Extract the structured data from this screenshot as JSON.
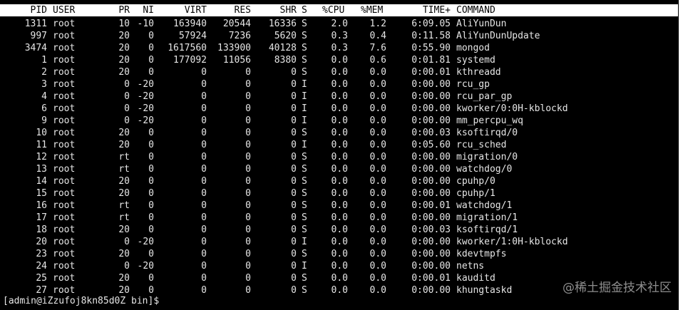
{
  "columns": {
    "pid": "PID",
    "user": "USER",
    "pr": "PR",
    "ni": "NI",
    "virt": "VIRT",
    "res": "RES",
    "shr": "SHR",
    "s": "S",
    "cpu": "%CPU",
    "mem": "%MEM",
    "time": "TIME+",
    "command": "COMMAND"
  },
  "processes": [
    {
      "pid": "1311",
      "user": "root",
      "pr": "10",
      "ni": "-10",
      "virt": "163940",
      "res": "20544",
      "shr": "16336",
      "s": "S",
      "cpu": "2.0",
      "mem": "1.2",
      "time": "6:09.05",
      "command": "AliYunDun"
    },
    {
      "pid": "997",
      "user": "root",
      "pr": "20",
      "ni": "0",
      "virt": "57924",
      "res": "7236",
      "shr": "5620",
      "s": "S",
      "cpu": "0.3",
      "mem": "0.4",
      "time": "0:11.58",
      "command": "AliYunDunUpdate"
    },
    {
      "pid": "3474",
      "user": "root",
      "pr": "20",
      "ni": "0",
      "virt": "1617560",
      "res": "133900",
      "shr": "40128",
      "s": "S",
      "cpu": "0.3",
      "mem": "7.6",
      "time": "0:55.90",
      "command": "mongod"
    },
    {
      "pid": "1",
      "user": "root",
      "pr": "20",
      "ni": "0",
      "virt": "177092",
      "res": "11056",
      "shr": "8380",
      "s": "S",
      "cpu": "0.0",
      "mem": "0.6",
      "time": "0:01.81",
      "command": "systemd"
    },
    {
      "pid": "2",
      "user": "root",
      "pr": "20",
      "ni": "0",
      "virt": "0",
      "res": "0",
      "shr": "0",
      "s": "S",
      "cpu": "0.0",
      "mem": "0.0",
      "time": "0:00.01",
      "command": "kthreadd"
    },
    {
      "pid": "3",
      "user": "root",
      "pr": "0",
      "ni": "-20",
      "virt": "0",
      "res": "0",
      "shr": "0",
      "s": "I",
      "cpu": "0.0",
      "mem": "0.0",
      "time": "0:00.00",
      "command": "rcu_gp"
    },
    {
      "pid": "4",
      "user": "root",
      "pr": "0",
      "ni": "-20",
      "virt": "0",
      "res": "0",
      "shr": "0",
      "s": "I",
      "cpu": "0.0",
      "mem": "0.0",
      "time": "0:00.00",
      "command": "rcu_par_gp"
    },
    {
      "pid": "6",
      "user": "root",
      "pr": "0",
      "ni": "-20",
      "virt": "0",
      "res": "0",
      "shr": "0",
      "s": "I",
      "cpu": "0.0",
      "mem": "0.0",
      "time": "0:00.00",
      "command": "kworker/0:0H-kblockd"
    },
    {
      "pid": "9",
      "user": "root",
      "pr": "0",
      "ni": "-20",
      "virt": "0",
      "res": "0",
      "shr": "0",
      "s": "I",
      "cpu": "0.0",
      "mem": "0.0",
      "time": "0:00.00",
      "command": "mm_percpu_wq"
    },
    {
      "pid": "10",
      "user": "root",
      "pr": "20",
      "ni": "0",
      "virt": "0",
      "res": "0",
      "shr": "0",
      "s": "S",
      "cpu": "0.0",
      "mem": "0.0",
      "time": "0:00.03",
      "command": "ksoftirqd/0"
    },
    {
      "pid": "11",
      "user": "root",
      "pr": "20",
      "ni": "0",
      "virt": "0",
      "res": "0",
      "shr": "0",
      "s": "I",
      "cpu": "0.0",
      "mem": "0.0",
      "time": "0:05.60",
      "command": "rcu_sched"
    },
    {
      "pid": "12",
      "user": "root",
      "pr": "rt",
      "ni": "0",
      "virt": "0",
      "res": "0",
      "shr": "0",
      "s": "S",
      "cpu": "0.0",
      "mem": "0.0",
      "time": "0:00.00",
      "command": "migration/0"
    },
    {
      "pid": "13",
      "user": "root",
      "pr": "rt",
      "ni": "0",
      "virt": "0",
      "res": "0",
      "shr": "0",
      "s": "S",
      "cpu": "0.0",
      "mem": "0.0",
      "time": "0:00.00",
      "command": "watchdog/0"
    },
    {
      "pid": "14",
      "user": "root",
      "pr": "20",
      "ni": "0",
      "virt": "0",
      "res": "0",
      "shr": "0",
      "s": "S",
      "cpu": "0.0",
      "mem": "0.0",
      "time": "0:00.00",
      "command": "cpuhp/0"
    },
    {
      "pid": "15",
      "user": "root",
      "pr": "20",
      "ni": "0",
      "virt": "0",
      "res": "0",
      "shr": "0",
      "s": "S",
      "cpu": "0.0",
      "mem": "0.0",
      "time": "0:00.00",
      "command": "cpuhp/1"
    },
    {
      "pid": "16",
      "user": "root",
      "pr": "rt",
      "ni": "0",
      "virt": "0",
      "res": "0",
      "shr": "0",
      "s": "S",
      "cpu": "0.0",
      "mem": "0.0",
      "time": "0:00.01",
      "command": "watchdog/1"
    },
    {
      "pid": "17",
      "user": "root",
      "pr": "rt",
      "ni": "0",
      "virt": "0",
      "res": "0",
      "shr": "0",
      "s": "S",
      "cpu": "0.0",
      "mem": "0.0",
      "time": "0:00.00",
      "command": "migration/1"
    },
    {
      "pid": "18",
      "user": "root",
      "pr": "20",
      "ni": "0",
      "virt": "0",
      "res": "0",
      "shr": "0",
      "s": "S",
      "cpu": "0.0",
      "mem": "0.0",
      "time": "0:00.03",
      "command": "ksoftirqd/1"
    },
    {
      "pid": "20",
      "user": "root",
      "pr": "0",
      "ni": "-20",
      "virt": "0",
      "res": "0",
      "shr": "0",
      "s": "I",
      "cpu": "0.0",
      "mem": "0.0",
      "time": "0:00.00",
      "command": "kworker/1:0H-kblockd"
    },
    {
      "pid": "23",
      "user": "root",
      "pr": "20",
      "ni": "0",
      "virt": "0",
      "res": "0",
      "shr": "0",
      "s": "S",
      "cpu": "0.0",
      "mem": "0.0",
      "time": "0:00.00",
      "command": "kdevtmpfs"
    },
    {
      "pid": "24",
      "user": "root",
      "pr": "0",
      "ni": "-20",
      "virt": "0",
      "res": "0",
      "shr": "0",
      "s": "I",
      "cpu": "0.0",
      "mem": "0.0",
      "time": "0:00.00",
      "command": "netns"
    },
    {
      "pid": "25",
      "user": "root",
      "pr": "20",
      "ni": "0",
      "virt": "0",
      "res": "0",
      "shr": "0",
      "s": "S",
      "cpu": "0.0",
      "mem": "0.0",
      "time": "0:00.01",
      "command": "kauditd"
    },
    {
      "pid": "27",
      "user": "root",
      "pr": "20",
      "ni": "0",
      "virt": "0",
      "res": "0",
      "shr": "0",
      "s": "S",
      "cpu": "0.0",
      "mem": "0.0",
      "time": "0:00.00",
      "command": "khungtaskd"
    }
  ],
  "prompt": "[admin@iZzufoj8kn85d0Z bin]$",
  "watermark": "@稀土掘金技术社区",
  "colors": {
    "background": "#000000",
    "text": "#e6e6e6",
    "header_background": "#ffffff",
    "header_text": "#000000"
  }
}
